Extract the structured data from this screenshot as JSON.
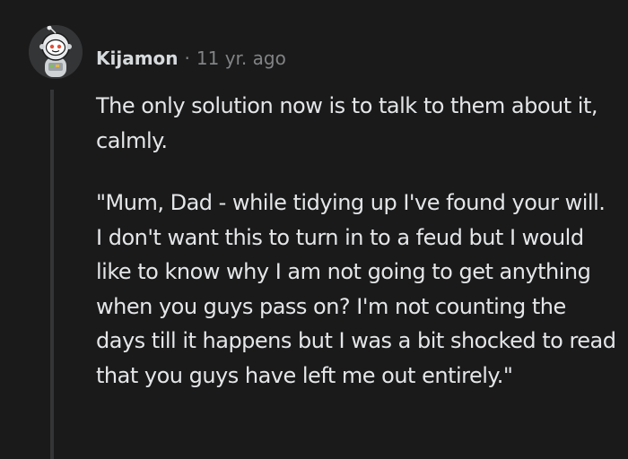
{
  "comment": {
    "author": "Kijamon",
    "separator": "·",
    "timestamp": "11 yr. ago",
    "avatar_icon": "snoo-astronaut-avatar-icon",
    "paragraphs": [
      "The only solution now is to talk to them about it, calmly.",
      "\"Mum, Dad - while tidying up I've found your will. I don't want this to turn in to a feud but I would like to know why I am not going to get anything when you guys pass on? I'm not counting the days till it happens but I was a bit shocked to read that you guys have left me out entirely.\""
    ]
  },
  "colors": {
    "background": "#1a1a1b",
    "text": "#d7dadc",
    "muted": "#818384",
    "thread_line": "#343536"
  }
}
